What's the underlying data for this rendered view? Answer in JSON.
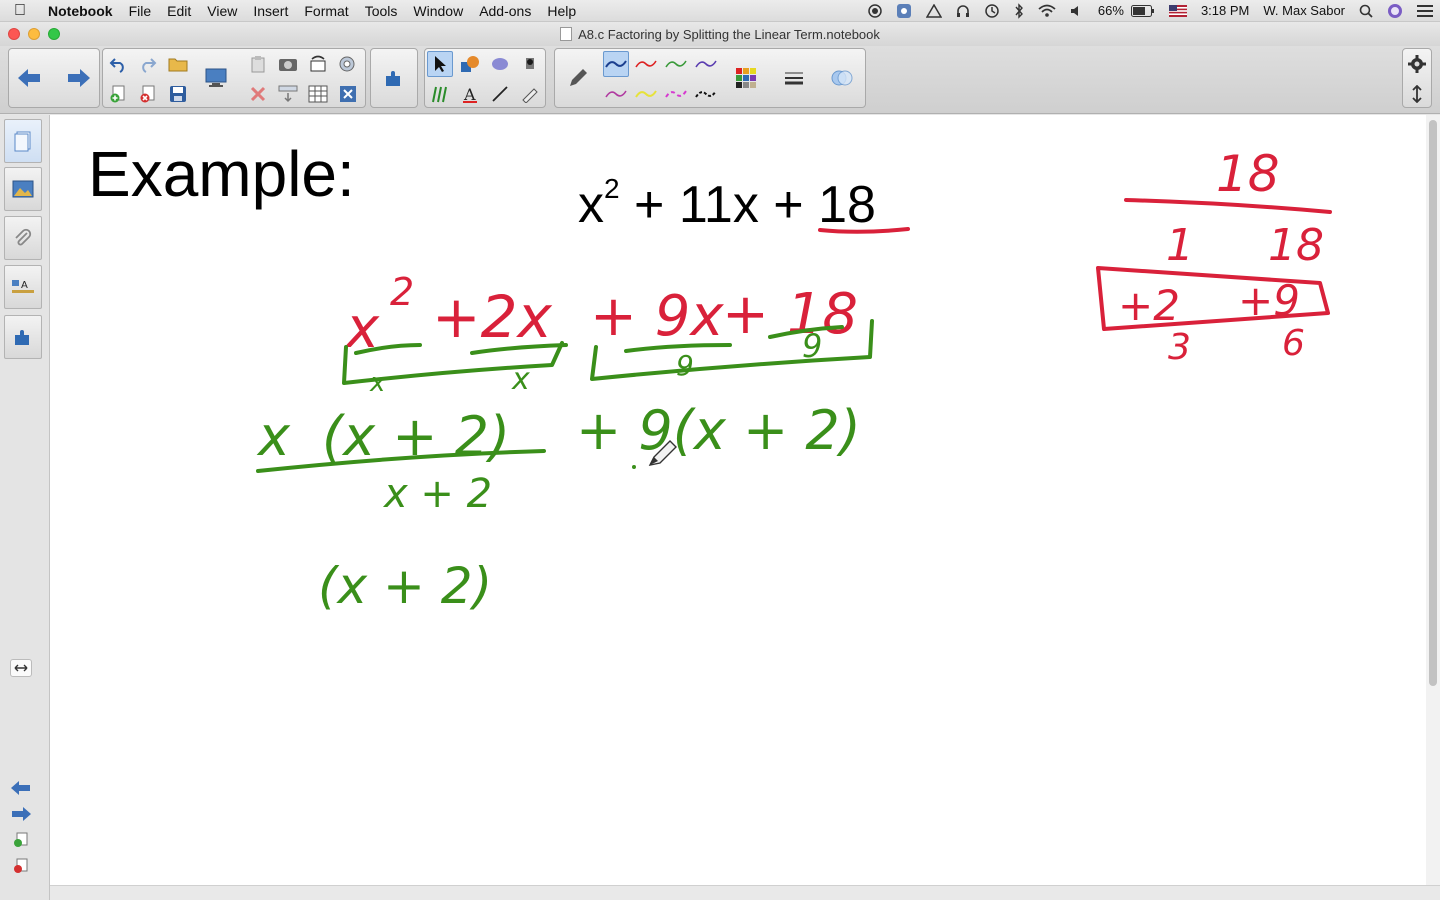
{
  "menubar": {
    "app_name": "Notebook",
    "items": [
      "File",
      "Edit",
      "View",
      "Insert",
      "Format",
      "Tools",
      "Window",
      "Add-ons",
      "Help"
    ],
    "battery": "66%",
    "time": "3:18 PM",
    "user": "W. Max Sabor"
  },
  "window": {
    "title": "A8.c Factoring by Splitting the Linear Term.notebook"
  },
  "canvas": {
    "heading": "Example:",
    "expression": {
      "base": "x",
      "exp": "2",
      "rest": " + 11x + ",
      "constant": "18"
    },
    "ink_red": {
      "factor_top": "18",
      "pair1_left": "1",
      "pair1_right": "18",
      "pair2_left": "+2",
      "pair2_right": "+9",
      "pair3_left": "3",
      "pair3_right": "6",
      "split_x2": "x",
      "split_x2_exp": "2",
      "split_2x": "+2x",
      "split_9x": "+ 9x",
      "split_plus18": "+ 18"
    },
    "ink_green": {
      "gcf1": "x",
      "gcf1b": "x",
      "gcf2": "9",
      "gcf2b": "9",
      "line2_x": "x",
      "line2_paren": "(x + 2)",
      "line2_plus9": "+ 9(x + 2)",
      "line3_under": "x + 2",
      "line4": "(x + 2)"
    }
  },
  "colors": {
    "red_ink": "#d9213a",
    "green_ink": "#3a8f1a",
    "select_highlight": "#b9d4f3"
  },
  "icons": {
    "toolbar": [
      "back-arrow-icon",
      "forward-arrow-icon",
      "undo-icon",
      "redo-icon",
      "open-folder-icon",
      "add-page-icon",
      "delete-page-icon",
      "save-icon",
      "screen-shade-icon",
      "paste-icon",
      "delete-icon",
      "screen-capture-icon",
      "table-icon",
      "pen-select-icon",
      "addons-icon",
      "select-arrow-icon",
      "shapes-icon",
      "eraser-icon",
      "fill-icon",
      "creative-pen-icon",
      "text-icon",
      "line-icon",
      "magic-pen-icon",
      "pen-icon",
      "color-palette-icon",
      "line-style-icon",
      "fill-effects-icon",
      "settings-gear-icon",
      "move-toolbar-icon"
    ],
    "sidebar": [
      "page-sorter-icon",
      "gallery-icon",
      "attachments-icon",
      "properties-icon",
      "addons-icon",
      "resize-handle-icon",
      "previous-page-icon",
      "next-page-icon",
      "add-page-icon",
      "delete-page-icon"
    ]
  }
}
